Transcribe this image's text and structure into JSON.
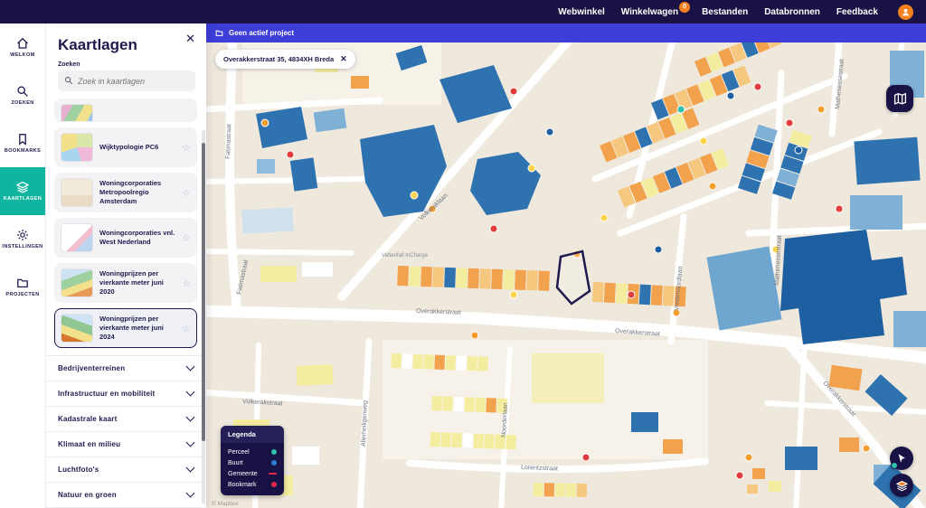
{
  "theme": {
    "navy": "#191345",
    "banner_blue": "#3d3dd8",
    "accent_teal": "#10b5a0",
    "accent_orange": "#f5821f"
  },
  "topbar": {
    "links": [
      {
        "label": "Webwinkel"
      },
      {
        "label": "Winkelwagen",
        "badge": "0"
      },
      {
        "label": "Bestanden"
      },
      {
        "label": "Databronnen"
      },
      {
        "label": "Feedback"
      }
    ]
  },
  "rail": {
    "items": [
      {
        "label": "WELKOM",
        "icon": "home-icon"
      },
      {
        "label": "ZOEKEN",
        "icon": "search-icon"
      },
      {
        "label": "BOOKMARKS",
        "icon": "bookmark-icon"
      },
      {
        "label": "KAARTLAGEN",
        "icon": "layers-icon",
        "active": true
      },
      {
        "label": "INSTELLINGEN",
        "icon": "gear-icon"
      },
      {
        "label": "PROJECTEN",
        "icon": "folder-icon"
      }
    ]
  },
  "sidebar": {
    "title": "Kaartlagen",
    "search_label": "Zoeken",
    "search_placeholder": "Zoek in kaartlagen",
    "layers": [
      {
        "label": "Wijktypologie PC6"
      },
      {
        "label": "Woningcorporaties Metropoolregio Amsterdam"
      },
      {
        "label": "Woningcorporaties vnl. West Nederland"
      },
      {
        "label": "Woningprijzen per vierkante meter juni 2020"
      },
      {
        "label": "Woningprijzen per vierkante meter juni 2024",
        "selected": true
      }
    ],
    "sections": [
      {
        "label": "Bedrijventerreinen"
      },
      {
        "label": "Infrastructuur en mobiliteit"
      },
      {
        "label": "Kadastrale kaart"
      },
      {
        "label": "Klimaat en milieu"
      },
      {
        "label": "Luchtfoto's"
      },
      {
        "label": "Natuur en groen"
      }
    ]
  },
  "map": {
    "banner": "Geen actief project",
    "chip": "Overakkerstraat 35, 4834XH Breda",
    "poi_label": "Vattenfall InCharge",
    "attribution": "© Mapbox",
    "street_labels": [
      "Fatimastraat",
      "Fatimastraat",
      "Volkeraklaan",
      "Volkerakstraat",
      "Mathenessestraat",
      "Mathenessestraat",
      "Overakkerstraat",
      "Overakkerstraat",
      "Overakkerstraat",
      "Vredenoordlaan",
      "Lorentzstraat",
      "Allerheiligenweg",
      "Noorderlaan"
    ],
    "legend": {
      "title": "Legenda",
      "items": [
        {
          "label": "Perceel",
          "color": "#2fbfad",
          "shape": "dot"
        },
        {
          "label": "Buurt",
          "color": "#2f7fd0",
          "shape": "dot"
        },
        {
          "label": "Gemeente",
          "color": "#e8274b",
          "shape": "line"
        },
        {
          "label": "Bookmark",
          "color": "#e8274b",
          "shape": "dot"
        }
      ]
    }
  }
}
